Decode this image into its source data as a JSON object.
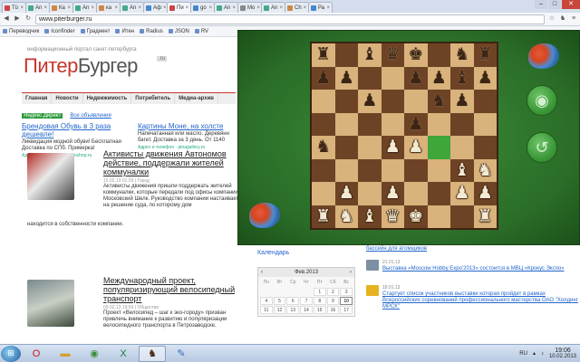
{
  "browser": {
    "tabs": [
      {
        "label": "Tü",
        "color": "#c44"
      },
      {
        "label": "An",
        "color": "#4a8"
      },
      {
        "label": "Ка",
        "color": "#c84"
      },
      {
        "label": "An",
        "color": "#4a8"
      },
      {
        "label": "ка",
        "color": "#c84"
      },
      {
        "label": "An",
        "color": "#4a8"
      },
      {
        "label": "Аф",
        "color": "#48c"
      },
      {
        "label": "Пи",
        "color": "#c44",
        "active": true
      },
      {
        "label": "go",
        "color": "#48c"
      },
      {
        "label": "An",
        "color": "#4a8"
      },
      {
        "label": "Mo",
        "color": "#888"
      },
      {
        "label": "An",
        "color": "#4a8"
      },
      {
        "label": "Ch",
        "color": "#c84"
      },
      {
        "label": "Ра",
        "color": "#48c"
      }
    ],
    "url": "www.piterburger.ru",
    "bookmarks": [
      "Переводчик",
      "Iconfinder",
      "Градиент",
      "Итен",
      "Radius",
      "JSON",
      "RV"
    ]
  },
  "site": {
    "tagline": "информационный портал санкт-петербурга",
    "logo_part1": "Питер",
    "logo_part2": "Бургер",
    "logo_suffix": ".ru",
    "nav": [
      "Главная",
      "Новости",
      "Недвижимость",
      "Потребитель",
      "Медиа-архив"
    ],
    "ads_label": "Яндекс.Директ",
    "all_ads": "Все объявления",
    "ad1": {
      "title": "Брендовая Обувь в 3 раза дешевле!",
      "desc": "Ликвидация модной обуви! Бесплатная Доставка по СПб. Примерка!",
      "link": "Адрес и телефон · fashionshop.ru"
    },
    "ad2": {
      "title": "Картины Моне, на холсте",
      "desc": "Напечатанная или масло. Деревянн багет. Доставка за 3 день. От 1140",
      "link": "Адрес и телефон · pinagallery.ru"
    },
    "news1": {
      "title": "Активисты движения Автономов действие, поддержали жителей коммуналки",
      "meta": "15.02.13 01:29 | Город",
      "summary": "Активисты движения пришли поддержать жителей коммуналки, которые передали под офисы компании Московский Шелк. Руководство компании настаивает на решение суда, по которому дом",
      "cont": "находится в собственности компании."
    },
    "news2": {
      "title": "Международный проект, популяризирующий велосипедный транспорт",
      "meta": "09.02.13 19:59 | Общество",
      "summary": "Проект «Велосипед – шаг к эко-городу» призван привлечь внимание к развитию и популяризации велосипедного транспорта в Петрозаводске."
    },
    "calendar_link": "Календарь",
    "calendar": {
      "month": "Фев.2013",
      "weekdays": [
        "Пн",
        "Вт",
        "Ср",
        "Чт",
        "Пт",
        "Сб",
        "Вс"
      ],
      "days": [
        "",
        "",
        "",
        "",
        "1",
        "2",
        "3",
        "4",
        "5",
        "6",
        "7",
        "8",
        "9",
        "10",
        "11",
        "12",
        "13",
        "14",
        "15",
        "16",
        "17"
      ]
    },
    "side_news": [
      {
        "text": "бассейн для атомщиков",
        "date": ""
      },
      {
        "text": "Выставка «Moscow Hobby Expo'2013» состоится в МВЦ «Крокус Экспо»",
        "date": "21.01.13"
      },
      {
        "text": "Стартует список участников выставки которая пройдет в рамках Всероссийских соревнований профессионального мастерства ОАО \"Холдинг МРСК\"",
        "date": "18.01.13"
      }
    ]
  },
  "chess": {
    "board": [
      [
        "r",
        "",
        "b",
        "q",
        "k",
        "",
        "n",
        "r"
      ],
      [
        "p",
        "p",
        "",
        "",
        "p",
        "p",
        "b",
        "p"
      ],
      [
        "",
        "",
        "p",
        "",
        "",
        "n",
        "p",
        ""
      ],
      [
        "",
        "",
        "",
        "",
        "p",
        "",
        "",
        ""
      ],
      [
        "n",
        "",
        "",
        "P",
        "P",
        "",
        "",
        ""
      ],
      [
        "",
        "",
        "",
        "",
        "",
        "",
        "B",
        "N"
      ],
      [
        "",
        "P",
        "",
        "P",
        "",
        "",
        "P",
        "P"
      ],
      [
        "R",
        "N",
        "B",
        "Q",
        "K",
        "",
        "",
        "R"
      ]
    ],
    "highlight": [
      [
        4,
        5
      ]
    ],
    "buttons": [
      "eye-icon",
      "undo-icon"
    ]
  },
  "taskbar": {
    "apps": [
      "Opera",
      "Folder",
      "Chrome",
      "Excel",
      "Chess",
      "Paint"
    ],
    "lang": "RU",
    "time": "19:06",
    "date": "10.02.2013"
  },
  "colors": {
    "brand_red": "#c6362d",
    "felt": "#2f7a2c",
    "light_square": "#d9b27c",
    "dark_square": "#6e4325"
  }
}
